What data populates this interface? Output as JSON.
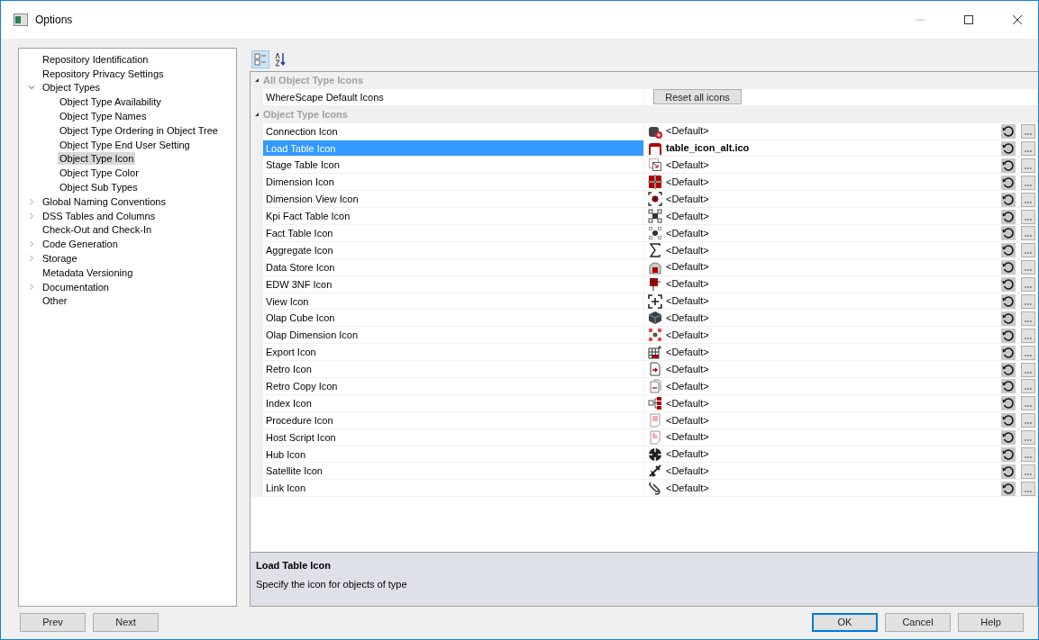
{
  "window": {
    "title": "Options"
  },
  "tree": [
    {
      "label": "Repository Identification",
      "selected": false
    },
    {
      "label": "Repository Privacy Settings",
      "selected": false
    },
    {
      "label": "Object Types",
      "selected": false,
      "expanded": true,
      "children": [
        {
          "label": "Object Type Availability",
          "selected": false
        },
        {
          "label": "Object Type Names",
          "selected": false
        },
        {
          "label": "Object Type Ordering in Object Tree",
          "selected": false
        },
        {
          "label": "Object Type End User Setting",
          "selected": false
        },
        {
          "label": "Object Type Icon",
          "selected": true
        },
        {
          "label": "Object Type Color",
          "selected": false
        },
        {
          "label": "Object Sub Types",
          "selected": false
        }
      ]
    },
    {
      "label": "Global Naming Conventions",
      "selected": false,
      "expanded": false
    },
    {
      "label": "DSS Tables and Columns",
      "selected": false,
      "expanded": false
    },
    {
      "label": "Check-Out and Check-In",
      "selected": false
    },
    {
      "label": "Code Generation",
      "selected": false,
      "expanded": false
    },
    {
      "label": "Storage",
      "selected": false,
      "expanded": false
    },
    {
      "label": "Metadata Versioning",
      "selected": false
    },
    {
      "label": "Documentation",
      "selected": false,
      "expanded": false
    },
    {
      "label": "Other",
      "selected": false
    }
  ],
  "toolbar": {
    "categorized_selected": true,
    "alphabetical_selected": false
  },
  "categories": [
    {
      "title": "All Object Type Icons",
      "expanded": true,
      "properties": [
        {
          "kind": "button",
          "name": "WhereScape Default Icons",
          "value": "Reset all icons",
          "selected": false
        }
      ]
    },
    {
      "title": "Object Type Icons",
      "expanded": true,
      "properties": [
        {
          "kind": "icon",
          "name": "Connection Icon",
          "value": "<Default>",
          "modified": false,
          "selected": false
        },
        {
          "kind": "icon",
          "name": "Load Table Icon",
          "value": "table_icon_alt.ico",
          "modified": true,
          "selected": true
        },
        {
          "kind": "icon",
          "name": "Stage Table Icon",
          "value": "<Default>",
          "modified": false,
          "selected": false
        },
        {
          "kind": "icon",
          "name": "Dimension Icon",
          "value": "<Default>",
          "modified": false,
          "selected": false
        },
        {
          "kind": "icon",
          "name": "Dimension View Icon",
          "value": "<Default>",
          "modified": false,
          "selected": false
        },
        {
          "kind": "icon",
          "name": "Kpi Fact Table Icon",
          "value": "<Default>",
          "modified": false,
          "selected": false
        },
        {
          "kind": "icon",
          "name": "Fact Table Icon",
          "value": "<Default>",
          "modified": false,
          "selected": false
        },
        {
          "kind": "icon",
          "name": "Aggregate Icon",
          "value": "<Default>",
          "modified": false,
          "selected": false
        },
        {
          "kind": "icon",
          "name": "Data Store Icon",
          "value": "<Default>",
          "modified": false,
          "selected": false
        },
        {
          "kind": "icon",
          "name": "EDW 3NF Icon",
          "value": "<Default>",
          "modified": false,
          "selected": false
        },
        {
          "kind": "icon",
          "name": "View Icon",
          "value": "<Default>",
          "modified": false,
          "selected": false
        },
        {
          "kind": "icon",
          "name": "Olap Cube Icon",
          "value": "<Default>",
          "modified": false,
          "selected": false
        },
        {
          "kind": "icon",
          "name": "Olap Dimension Icon",
          "value": "<Default>",
          "modified": false,
          "selected": false
        },
        {
          "kind": "icon",
          "name": "Export Icon",
          "value": "<Default>",
          "modified": false,
          "selected": false
        },
        {
          "kind": "icon",
          "name": "Retro Icon",
          "value": "<Default>",
          "modified": false,
          "selected": false
        },
        {
          "kind": "icon",
          "name": "Retro Copy Icon",
          "value": "<Default>",
          "modified": false,
          "selected": false
        },
        {
          "kind": "icon",
          "name": "Index Icon",
          "value": "<Default>",
          "modified": false,
          "selected": false
        },
        {
          "kind": "icon",
          "name": "Procedure Icon",
          "value": "<Default>",
          "modified": false,
          "selected": false
        },
        {
          "kind": "icon",
          "name": "Host Script Icon",
          "value": "<Default>",
          "modified": false,
          "selected": false
        },
        {
          "kind": "icon",
          "name": "Hub Icon",
          "value": "<Default>",
          "modified": false,
          "selected": false
        },
        {
          "kind": "icon",
          "name": "Satellite Icon",
          "value": "<Default>",
          "modified": false,
          "selected": false
        },
        {
          "kind": "icon",
          "name": "Link Icon",
          "value": "<Default>",
          "modified": false,
          "selected": false
        }
      ]
    }
  ],
  "description": {
    "title": "Load Table Icon",
    "text": "Specify the icon for objects of type"
  },
  "buttons_left": [
    "Prev",
    "Next"
  ],
  "buttons_right": [
    {
      "label": "OK",
      "default": true
    },
    {
      "label": "Cancel",
      "default": false
    },
    {
      "label": "Help",
      "default": false
    }
  ]
}
